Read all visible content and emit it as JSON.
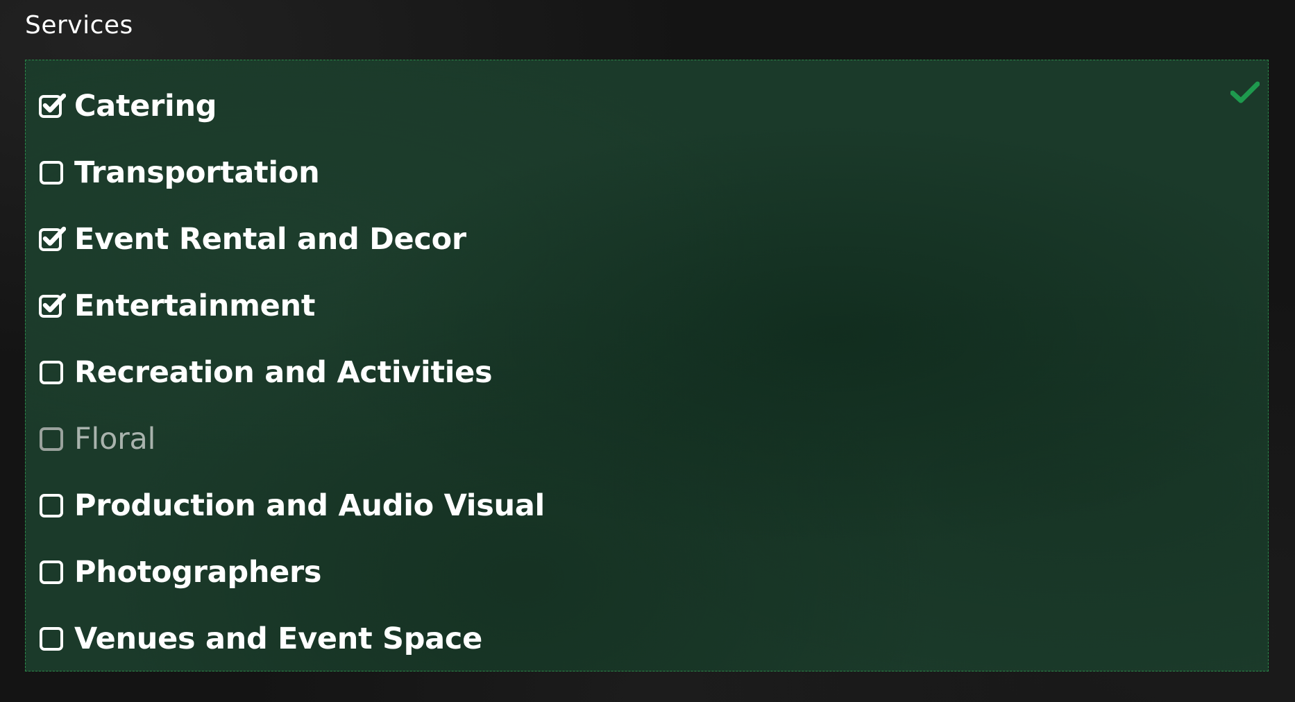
{
  "field": {
    "label": "Services"
  },
  "panel": {
    "valid_icon": "checkmark-icon",
    "accent_color": "#2b8a4a",
    "background_color": "#1b3a2a"
  },
  "services": [
    {
      "label": "Catering",
      "checked": true,
      "disabled": false
    },
    {
      "label": "Transportation",
      "checked": false,
      "disabled": false
    },
    {
      "label": "Event Rental and Decor",
      "checked": true,
      "disabled": false
    },
    {
      "label": "Entertainment",
      "checked": true,
      "disabled": false
    },
    {
      "label": "Recreation and Activities",
      "checked": false,
      "disabled": false
    },
    {
      "label": "Floral",
      "checked": false,
      "disabled": true
    },
    {
      "label": "Production and Audio Visual",
      "checked": false,
      "disabled": false
    },
    {
      "label": "Photographers",
      "checked": false,
      "disabled": false
    },
    {
      "label": "Venues and Event Space",
      "checked": false,
      "disabled": false
    }
  ]
}
